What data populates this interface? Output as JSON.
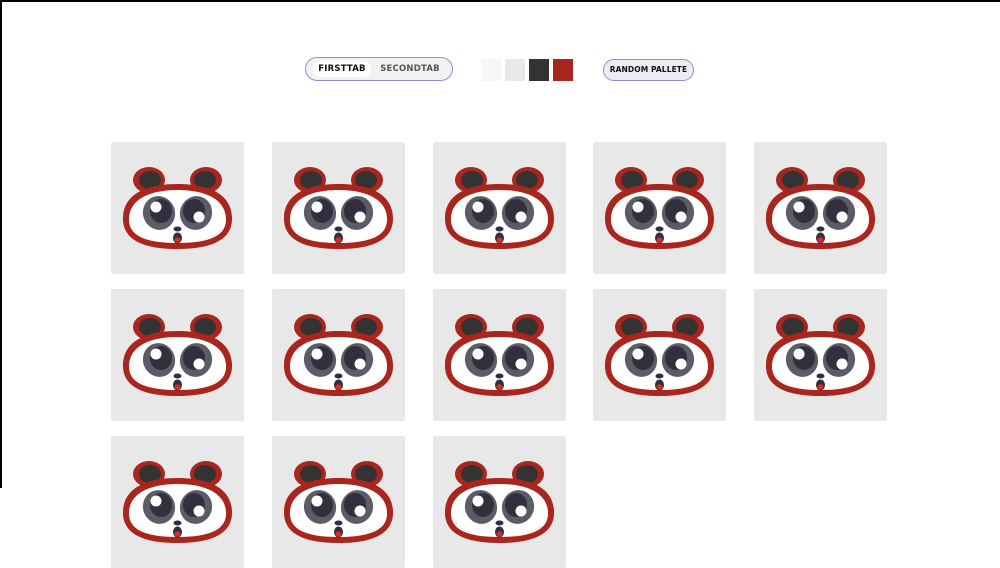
{
  "tabs": [
    {
      "label": "FIRSTTAB",
      "active": true
    },
    {
      "label": "SECONDTAB",
      "active": false
    }
  ],
  "palette": [
    "#f7f7f7",
    "#e8e8e8",
    "#333333",
    "#a8261e"
  ],
  "random_button": {
    "label": "RANDOM PALLETE"
  },
  "card_background": "#e8e8e8",
  "panda": {
    "outline": "#a8261e",
    "face": "#ffffff",
    "ears": "#333333",
    "eye_patch": "#5a5c66",
    "eye": "#332f3f",
    "mouth": "#d92b22",
    "icon": "panda-face-icon"
  },
  "cards": [
    {
      "variant": "panda"
    },
    {
      "variant": "panda"
    },
    {
      "variant": "panda"
    },
    {
      "variant": "panda"
    },
    {
      "variant": "panda"
    },
    {
      "variant": "panda"
    },
    {
      "variant": "panda"
    },
    {
      "variant": "panda"
    },
    {
      "variant": "panda"
    },
    {
      "variant": "panda"
    },
    {
      "variant": "panda"
    },
    {
      "variant": "panda"
    },
    {
      "variant": "panda"
    }
  ]
}
